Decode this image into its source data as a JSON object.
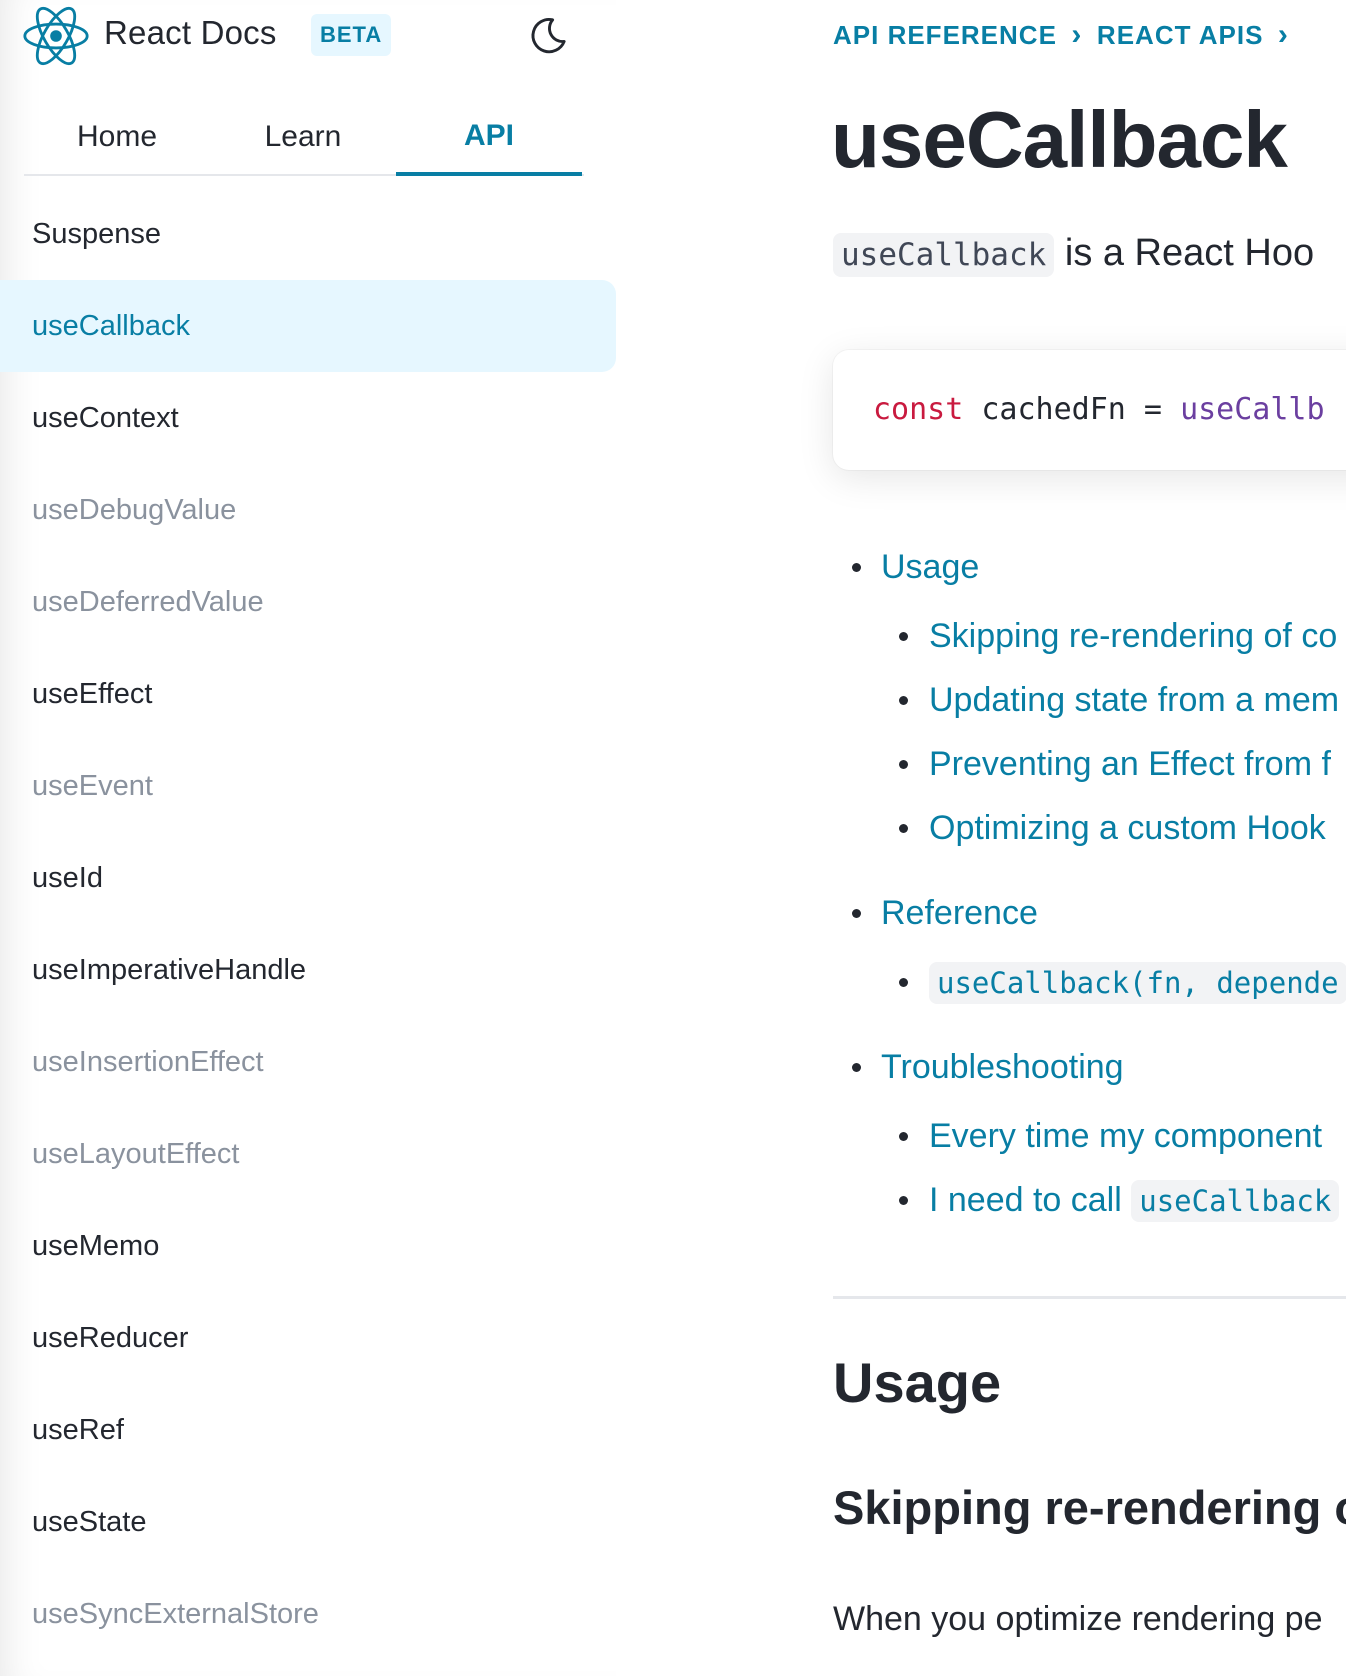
{
  "header": {
    "brand": "React Docs",
    "badge": "BETA",
    "theme_toggle_icon": "moon-icon",
    "logo_icon": "react-logo-icon"
  },
  "tabs": [
    {
      "label": "Home",
      "active": false
    },
    {
      "label": "Learn",
      "active": false
    },
    {
      "label": "API",
      "active": true
    }
  ],
  "sidebar": {
    "items": [
      {
        "label": "Suspense",
        "muted": false,
        "active": false
      },
      {
        "label": "useCallback",
        "muted": false,
        "active": true
      },
      {
        "label": "useContext",
        "muted": false,
        "active": false
      },
      {
        "label": "useDebugValue",
        "muted": true,
        "active": false
      },
      {
        "label": "useDeferredValue",
        "muted": true,
        "active": false
      },
      {
        "label": "useEffect",
        "muted": false,
        "active": false
      },
      {
        "label": "useEvent",
        "muted": true,
        "active": false
      },
      {
        "label": "useId",
        "muted": false,
        "active": false
      },
      {
        "label": "useImperativeHandle",
        "muted": false,
        "active": false
      },
      {
        "label": "useInsertionEffect",
        "muted": true,
        "active": false
      },
      {
        "label": "useLayoutEffect",
        "muted": true,
        "active": false
      },
      {
        "label": "useMemo",
        "muted": false,
        "active": false
      },
      {
        "label": "useReducer",
        "muted": false,
        "active": false
      },
      {
        "label": "useRef",
        "muted": false,
        "active": false
      },
      {
        "label": "useState",
        "muted": false,
        "active": false
      },
      {
        "label": "useSyncExternalStore",
        "muted": true,
        "active": false
      }
    ]
  },
  "breadcrumb": [
    "API REFERENCE",
    "REACT APIS"
  ],
  "main": {
    "title": "useCallback",
    "intro_code": "useCallback",
    "intro_text": " is a React Hoo",
    "code": {
      "keyword": "const",
      "variable": " cachedFn = ",
      "call": "useCallb"
    },
    "toc": [
      {
        "level": 1,
        "label": "Usage"
      },
      {
        "level": 2,
        "label": "Skipping re-rendering of co"
      },
      {
        "level": 2,
        "label": "Updating state from a mem"
      },
      {
        "level": 2,
        "label": "Preventing an Effect from f"
      },
      {
        "level": 2,
        "label": "Optimizing a custom Hook"
      },
      {
        "level": 1,
        "label": "Reference"
      },
      {
        "level": 2,
        "code": "useCallback(fn, depende"
      },
      {
        "level": 1,
        "label": "Troubleshooting"
      },
      {
        "level": 2,
        "label": "Every time my component"
      },
      {
        "level": 2,
        "label": "I need to call ",
        "code": "useCallback"
      }
    ],
    "section_heading": "Usage",
    "subsection_heading": "Skipping re-rendering o",
    "paragraph": "When you optimize rendering pe"
  },
  "colors": {
    "accent": "#087ea4",
    "active_bg": "#e6f7ff",
    "text": "#23272f",
    "muted": "#8a929e",
    "keyword": "#c91a3f",
    "function": "#6b3fa0"
  }
}
